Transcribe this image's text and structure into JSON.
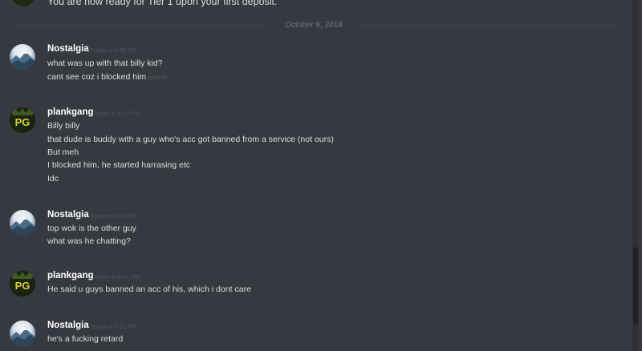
{
  "top_message": {
    "text": "You are now ready for Tier 1 upon your first deposit."
  },
  "date_divider": "October 8, 2018",
  "messages": [
    {
      "author": "Nostalgia",
      "time": "Today at 4:59 PM",
      "lines": [
        "what was up with that billy kid?",
        "cant see coz i blocked him"
      ],
      "edited": "(edited)"
    },
    {
      "author": "plankgang",
      "time": "Today at 5:00 PM",
      "lines": [
        "Billy billy",
        "that dude is buddy with a guy who's acc got banned from a service (not ours)",
        "But meh",
        "I blocked him, he started harrasing etc",
        "Idc"
      ]
    },
    {
      "author": "Nostalgia",
      "time": "Today at 5:01 PM",
      "lines": [
        "top wok is the other guy",
        "what was he chatting?"
      ]
    },
    {
      "author": "plankgang",
      "time": "Today at 5:01 PM",
      "lines": [
        "He said u guys banned an acc of his, which i dont care"
      ]
    },
    {
      "author": "Nostalgia",
      "time": "Today at 5:02 PM",
      "lines": [
        "he's a fucking retard"
      ]
    }
  ],
  "avatar_text": {
    "plankgang": "PG"
  },
  "colors": {
    "background": "#36393f",
    "username": "#ffffff",
    "text": "#dcddde",
    "timestamp": "#4f5359",
    "plank_avatar_text": "#d9d13a"
  },
  "icons": {
    "nostalgia": "mountain-landscape-avatar",
    "plankgang": "pg-logo-avatar"
  }
}
